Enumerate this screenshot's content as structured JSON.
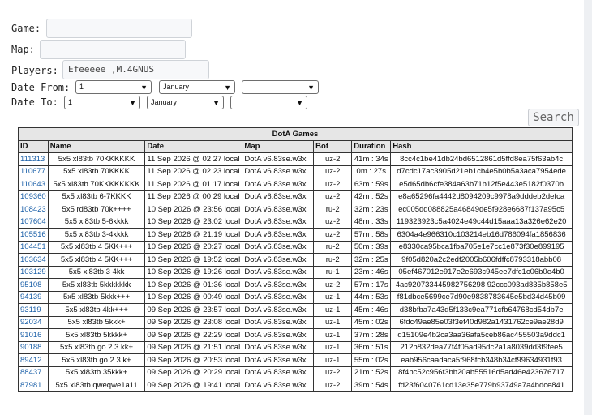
{
  "form": {
    "game_label": "Game:",
    "game_value": "",
    "map_label": "Map:",
    "map_value": "",
    "players_label": "Players:",
    "players_value": "Efeeeee ,M.4GNUS",
    "date_from_label": "Date From:",
    "date_to_label": "Date To:",
    "date_from": {
      "day": "1",
      "month": "January",
      "year": ""
    },
    "date_to": {
      "day": "1",
      "month": "January",
      "year": ""
    },
    "search_label": "Search"
  },
  "table": {
    "title": "DotA Games",
    "columns": [
      "ID",
      "Name",
      "Date",
      "Map",
      "Bot",
      "Duration",
      "Hash"
    ],
    "rows": [
      [
        "111313",
        "5x5 xl83tb 70KKKKKK",
        "11 Sep 2026 @ 02:27 local",
        "DotA v6.83se.w3x",
        "uz-2",
        "41m : 34s",
        "8cc4c1be41db24bd6512861d5ffd8ea75f63ab4c"
      ],
      [
        "110677",
        "5x5 xl83tb 70KKKK",
        "11 Sep 2026 @ 02:23 local",
        "DotA v6.83se.w3x",
        "uz-2",
        "0m : 27s",
        "d7cdc17ac3905d21eb1cb4e5b0b5a3aca7954ede"
      ],
      [
        "110643",
        "5x5 xl83tb 70KKKKKKKK",
        "11 Sep 2026 @ 01:17 local",
        "DotA v6.83se.w3x",
        "uz-2",
        "63m : 59s",
        "e5d65db6cfe384a63b71b12f5e443e5182f0370b"
      ],
      [
        "109360",
        "5x5 xl83tb 6-7KKKK",
        "11 Sep 2026 @ 00:29 local",
        "DotA v6.83se.w3x",
        "uz-2",
        "42m : 52s",
        "e8a65296fa4442d8094209c9978a9dddeb2defca"
      ],
      [
        "108423",
        "5x5 rd83tb 70k++++",
        "10 Sep 2026 @ 23:56 local",
        "DotA v6.83se.w3x",
        "ru-2",
        "32m : 23s",
        "ec005dd088825a46849de5f928e6687f137a95c5"
      ],
      [
        "107604",
        "5x5 xl83tb 5-6kkkk",
        "10 Sep 2026 @ 23:02 local",
        "DotA v6.83se.w3x",
        "uz-2",
        "48m : 33s",
        "119323923c5a4024e49c44d15aaa13a326e62e20"
      ],
      [
        "105516",
        "5x5 xl83tb 3-4kkkk",
        "10 Sep 2026 @ 21:19 local",
        "DotA v6.83se.w3x",
        "uz-2",
        "57m : 58s",
        "6304a4e966310c103214eb16d786094fa1856836"
      ],
      [
        "104451",
        "5x5 xl83tb 4 5KK+++",
        "10 Sep 2026 @ 20:27 local",
        "DotA v6.83se.w3x",
        "ru-2",
        "50m : 39s",
        "e8330ca95bca1fba705e1e7cc1e873f30e899195"
      ],
      [
        "103634",
        "5x5 xl83tb 4 5KK+++",
        "10 Sep 2026 @ 19:52 local",
        "DotA v6.83se.w3x",
        "ru-2",
        "32m : 25s",
        "9f05d820a2c2edf2005b606fdffc8793318abb08"
      ],
      [
        "103129",
        "5x5 xl83tb 3 4kk",
        "10 Sep 2026 @ 19:26 local",
        "DotA v6.83se.w3x",
        "ru-1",
        "23m : 46s",
        "05ef467012e917e2e693c945ee7dfc1c06b0e4b0"
      ],
      [
        "95108",
        "5x5 xl83tb 5kkkkkkk",
        "10 Sep 2026 @ 01:36 local",
        "DotA v6.83se.w3x",
        "uz-2",
        "57m : 17s",
        "4ac920733445982756298 92ccc093ad835b858e5"
      ],
      [
        "94139",
        "5x5 xl83tb 5kkk+++",
        "10 Sep 2026 @ 00:49 local",
        "DotA v6.83se.w3x",
        "uz-1",
        "44m : 53s",
        "f81dbce5699ce7d90e9838783645e5bd34d45b09"
      ],
      [
        "93119",
        "5x5 xl83tb 4kk+++",
        "09 Sep 2026 @ 23:57 local",
        "DotA v6.83se.w3x",
        "uz-1",
        "45m : 46s",
        "d38bfba7a43d5f133c9ea771cfb64768cd54db7e"
      ],
      [
        "92034",
        "5x5 xl83tb 5kkk+",
        "09 Sep 2026 @ 23:08 local",
        "DotA v6.83se.w3x",
        "uz-1",
        "45m : 02s",
        "6fdc49ae85e03f3ef40d982a1431762ce9ae28d9"
      ],
      [
        "91016",
        "5x5 xl83tb 5kkkk+",
        "09 Sep 2026 @ 22:29 local",
        "DotA v6.83se.w3x",
        "uz-1",
        "37m : 28s",
        "d15109e4b2ca3aa36afa5ceb86ac455503a9ddc1"
      ],
      [
        "90188",
        "5x5 xl83tb go 2 3 kk+",
        "09 Sep 2026 @ 21:51 local",
        "DotA v6.83se.w3x",
        "uz-1",
        "36m : 51s",
        "212b832dea77f4f05ad95dc2a1a8039dd3f9fee5"
      ],
      [
        "89412",
        "5x5 xl83tb go 2 3 k+",
        "09 Sep 2026 @ 20:53 local",
        "DotA v6.83se.w3x",
        "uz-1",
        "55m : 02s",
        "eab956caadaca5f968fcb348b34cf99634931f93"
      ],
      [
        "88437",
        "5x5 xl83tb 35kkk+",
        "09 Sep 2026 @ 20:29 local",
        "DotA v6.83se.w3x",
        "uz-2",
        "21m : 52s",
        "8f4bc52c956f3bb20ab55516d5ad46e423676717"
      ],
      [
        "87981",
        "5x5 xl83tb qweqwe1a11",
        "09 Sep 2026 @ 19:41 local",
        "DotA v6.83se.w3x",
        "uz-2",
        "39m : 54s",
        "fd23f6040761cd13e35e779b93749a7a4bdce841"
      ]
    ]
  }
}
